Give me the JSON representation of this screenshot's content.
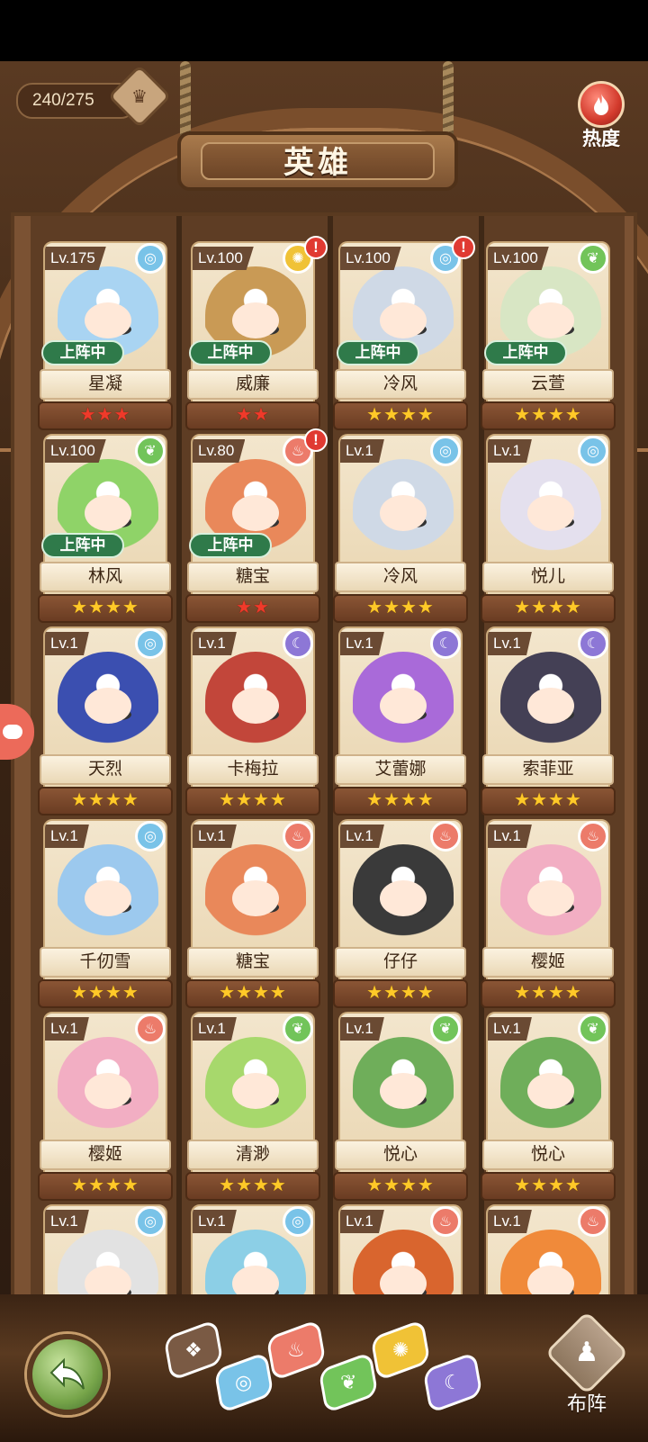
{
  "header": {
    "hero_count": "240/275",
    "title": "英雄",
    "hot_label": "热度",
    "badge_glyph": "♛"
  },
  "status": {
    "deployed_label": "上阵中"
  },
  "heroes": [
    {
      "name": "星凝",
      "level": "Lv.175",
      "element": "water",
      "element_glyph": "◎",
      "stars": "★★★",
      "star_color": "red",
      "deployed": true,
      "alert": false,
      "color": "#a9d4f2"
    },
    {
      "name": "威廉",
      "level": "Lv.100",
      "element": "light",
      "element_glyph": "✺",
      "stars": "★★",
      "star_color": "red",
      "deployed": true,
      "alert": true,
      "color": "#c99a55"
    },
    {
      "name": "冷风",
      "level": "Lv.100",
      "element": "water",
      "element_glyph": "◎",
      "stars": "★★★★",
      "star_color": "gold",
      "deployed": true,
      "alert": true,
      "color": "#cfd9e6"
    },
    {
      "name": "云萱",
      "level": "Lv.100",
      "element": "wind",
      "element_glyph": "❦",
      "stars": "★★★★",
      "star_color": "gold",
      "deployed": true,
      "alert": false,
      "color": "#d8e6c4"
    },
    {
      "name": "林风",
      "level": "Lv.100",
      "element": "wind",
      "element_glyph": "❦",
      "stars": "★★★★",
      "star_color": "gold",
      "deployed": true,
      "alert": false,
      "color": "#8fd368"
    },
    {
      "name": "糖宝",
      "level": "Lv.80",
      "element": "fire",
      "element_glyph": "♨",
      "stars": "★★",
      "star_color": "red",
      "deployed": true,
      "alert": true,
      "color": "#e9885a"
    },
    {
      "name": "冷风",
      "level": "Lv.1",
      "element": "water",
      "element_glyph": "◎",
      "stars": "★★★★",
      "star_color": "gold",
      "deployed": false,
      "alert": false,
      "color": "#cfd9e6"
    },
    {
      "name": "悦儿",
      "level": "Lv.1",
      "element": "water",
      "element_glyph": "◎",
      "stars": "★★★★",
      "star_color": "gold",
      "deployed": false,
      "alert": false,
      "color": "#e4e0ee"
    },
    {
      "name": "天烈",
      "level": "Lv.1",
      "element": "water",
      "element_glyph": "◎",
      "stars": "★★★★",
      "star_color": "gold",
      "deployed": false,
      "alert": false,
      "color": "#3b4fb0"
    },
    {
      "name": "卡梅拉",
      "level": "Lv.1",
      "element": "moon",
      "element_glyph": "☾",
      "stars": "★★★★",
      "star_color": "gold",
      "deployed": false,
      "alert": false,
      "color": "#c2463a"
    },
    {
      "name": "艾蕾娜",
      "level": "Lv.1",
      "element": "moon",
      "element_glyph": "☾",
      "stars": "★★★★",
      "star_color": "gold",
      "deployed": false,
      "alert": false,
      "color": "#a96ad9"
    },
    {
      "name": "索菲亚",
      "level": "Lv.1",
      "element": "moon",
      "element_glyph": "☾",
      "stars": "★★★★",
      "star_color": "gold",
      "deployed": false,
      "alert": false,
      "color": "#444055"
    },
    {
      "name": "千仞雪",
      "level": "Lv.1",
      "element": "water",
      "element_glyph": "◎",
      "stars": "★★★★",
      "star_color": "gold",
      "deployed": false,
      "alert": false,
      "color": "#9cc9ee"
    },
    {
      "name": "糖宝",
      "level": "Lv.1",
      "element": "fire",
      "element_glyph": "♨",
      "stars": "★★★★",
      "star_color": "gold",
      "deployed": false,
      "alert": false,
      "color": "#e9885a"
    },
    {
      "name": "仔仔",
      "level": "Lv.1",
      "element": "fire",
      "element_glyph": "♨",
      "stars": "★★★★",
      "star_color": "gold",
      "deployed": false,
      "alert": false,
      "color": "#3a3a3a"
    },
    {
      "name": "樱姬",
      "level": "Lv.1",
      "element": "fire",
      "element_glyph": "♨",
      "stars": "★★★★",
      "star_color": "gold",
      "deployed": false,
      "alert": false,
      "color": "#f2aec3"
    },
    {
      "name": "樱姬",
      "level": "Lv.1",
      "element": "fire",
      "element_glyph": "♨",
      "stars": "★★★★",
      "star_color": "gold",
      "deployed": false,
      "alert": false,
      "color": "#f2aec3"
    },
    {
      "name": "清渺",
      "level": "Lv.1",
      "element": "wind",
      "element_glyph": "❦",
      "stars": "★★★★",
      "star_color": "gold",
      "deployed": false,
      "alert": false,
      "color": "#a7d86c"
    },
    {
      "name": "悦心",
      "level": "Lv.1",
      "element": "wind",
      "element_glyph": "❦",
      "stars": "★★★★",
      "star_color": "gold",
      "deployed": false,
      "alert": false,
      "color": "#6fae5a"
    },
    {
      "name": "悦心",
      "level": "Lv.1",
      "element": "wind",
      "element_glyph": "❦",
      "stars": "★★★★",
      "star_color": "gold",
      "deployed": false,
      "alert": false,
      "color": "#6fae5a"
    },
    {
      "name": "",
      "level": "Lv.1",
      "element": "water",
      "element_glyph": "◎",
      "stars": "",
      "star_color": "gold",
      "deployed": false,
      "alert": false,
      "color": "#e2e2e2"
    },
    {
      "name": "",
      "level": "Lv.1",
      "element": "water",
      "element_glyph": "◎",
      "stars": "",
      "star_color": "gold",
      "deployed": false,
      "alert": false,
      "color": "#8ccfe6"
    },
    {
      "name": "",
      "level": "Lv.1",
      "element": "fire",
      "element_glyph": "♨",
      "stars": "",
      "star_color": "gold",
      "deployed": false,
      "alert": false,
      "color": "#d9652e"
    },
    {
      "name": "",
      "level": "Lv.1",
      "element": "fire",
      "element_glyph": "♨",
      "stars": "",
      "star_color": "gold",
      "deployed": false,
      "alert": false,
      "color": "#f08a3a"
    }
  ],
  "filters": [
    {
      "id": "all",
      "glyph": "❖",
      "color": "#7a5a44"
    },
    {
      "id": "water",
      "glyph": "◎",
      "color": "#79c3e8"
    },
    {
      "id": "fire",
      "glyph": "♨",
      "color": "#ec7b6a"
    },
    {
      "id": "wind",
      "glyph": "❦",
      "color": "#72c45a"
    },
    {
      "id": "light",
      "glyph": "✺",
      "color": "#f0c236"
    },
    {
      "id": "moon",
      "glyph": "☾",
      "color": "#8d77d6"
    }
  ],
  "footer": {
    "deploy_label": "布阵",
    "deploy_glyph": "♟",
    "back_glyph": "↶"
  }
}
